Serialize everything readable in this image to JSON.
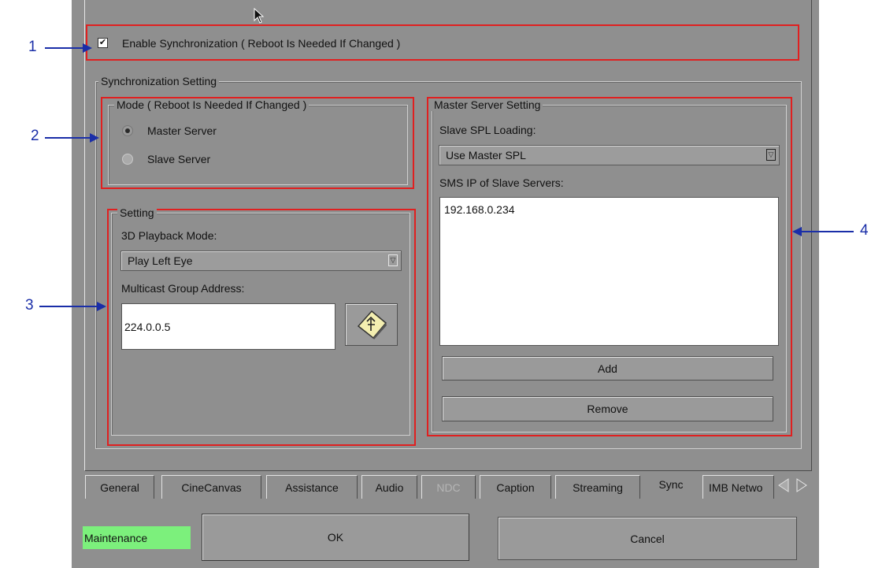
{
  "sync": {
    "enable_label": "Enable Synchronization ( Reboot Is Needed If Changed )",
    "enable_checked": true,
    "group_title": "Synchronization Setting",
    "mode": {
      "title": "Mode ( Reboot Is Needed If Changed )",
      "options": [
        "Master Server",
        "Slave Server"
      ],
      "selected": "Master Server"
    },
    "setting": {
      "title": "Setting",
      "playback_label": "3D Playback Mode:",
      "playback_value": "Play Left Eye",
      "multicast_label": "Multicast Group Address:",
      "multicast_value": "224.0.0.5"
    },
    "master": {
      "title": "Master Server Setting",
      "spl_label": "Slave SPL Loading:",
      "spl_value": "Use Master SPL",
      "sms_label": "SMS IP of Slave Servers:",
      "slave_ips": [
        "192.168.0.234"
      ],
      "add_label": "Add",
      "remove_label": "Remove"
    }
  },
  "tabs": [
    {
      "label": "General"
    },
    {
      "label": "CineCanvas"
    },
    {
      "label": "Assistance"
    },
    {
      "label": "Audio"
    },
    {
      "label": "NDC"
    },
    {
      "label": "Caption"
    },
    {
      "label": "Streaming"
    },
    {
      "label": "Sync"
    },
    {
      "label": "IMB Netwo"
    }
  ],
  "active_tab": "Sync",
  "footer": {
    "maintenance_label": "Maintenance",
    "maintenance_color": "#7cf07c",
    "ok_label": "OK",
    "cancel_label": "Cancel"
  },
  "annotations": [
    "1",
    "2",
    "3",
    "4"
  ],
  "colors": {
    "highlight": "#e02020",
    "annotation": "#1a2ea8",
    "dialog_bg": "#8f8f8f"
  }
}
